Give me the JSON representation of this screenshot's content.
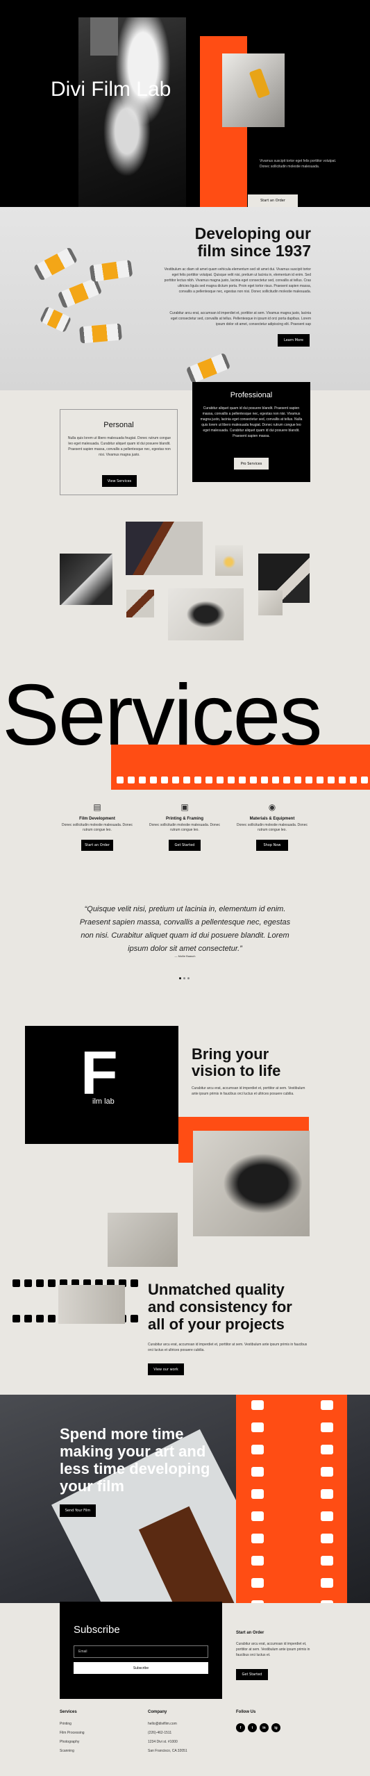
{
  "hero": {
    "title": "Divi Film Lab",
    "text": "Vivamus suscipit tortor eget felis porttitor volutpat. Donec sollicitudin molestie malesuada.",
    "cta_label": "Start an Order"
  },
  "film": {
    "title": "Developing our film since 1937",
    "p1": "Vestibulum ac diam sit amet quam vehicula elementum sed sit amet dui. Vivamus suscipit tortor eget felis porttitor volutpat. Quisque velit nisi, pretium ut lacinia in, elementum id enim. Sed porttitor lectus nibh. Vivamus magna justo, lacinia eget consectetur sed, convallis at tellus. Cras ultricies ligula sed magna dictum porta. Proin eget tortor risus. Praesent sapien massa, convallis a pellentesque nec, egestas non nisi. Donec sollicitudin molestie malesuada.",
    "p2": "Curabitur arcu erat, accumsan id imperdiet et, porttitor at sem. Vivamus magna justo, lacinia eget consectetur sed, convallis at tellus. Pellentesque in ipsum id orci porta dapibus. Lorem ipsum dolor sit amet, consectetur adipiscing elit. Praesent sap",
    "button": "Learn More"
  },
  "cards": {
    "personal": {
      "title": "Personal",
      "text": "Nulla quis lorem ut libero malesuada feugiat. Donec rutrum congue leo eget malesuada. Curabitur aliquet quam id dui posuere blandit. Praesent sapien massa, convallis a pellentesque nec, egestas non nisi. Vivamus magna justo.",
      "button": "View Services"
    },
    "professional": {
      "title": "Professional",
      "text": "Curabitur aliquet quam id dui posuere blandit. Praesent sapien massa, convallis a pellentesque nec, egestas non nisi. Vivamus magna justo, lacinia eget consectetur sed, convallis at tellus. Nulla quis lorem ut libero malesuada feugiat. Donec rutrum congue leo eget malesuada. Curabitur aliquet quam id dui posuere blandit. Praesent sapien massa.",
      "button": "Pro Services"
    }
  },
  "services": {
    "heading": "Services",
    "items": [
      {
        "name": "Film Development",
        "desc": "Donec sollicitudin molestie malesuada. Donec rutrum congue leo.",
        "button": "Start an Order",
        "icon": "film-canister-icon"
      },
      {
        "name": "Printing & Framing",
        "desc": "Donec sollicitudin molestie malesuada. Donec rutrum congue leo.",
        "button": "Get Started",
        "icon": "frame-icon"
      },
      {
        "name": "Materials & Equipment",
        "desc": "Donec sollicitudin molestie malesuada. Donec rutrum congue leo.",
        "button": "Shop Now",
        "icon": "camera-icon"
      }
    ]
  },
  "quote": {
    "text": "“Quisque velit nisi, pretium ut lacinia in, elementum id enim. Praesent sapien massa, convallis a pellentesque nec, egestas non nisi. Curabitur aliquet quam id dui posuere blandit. Lorem ipsum dolor sit amet consectetur.”",
    "author": "— Mollie Baasch"
  },
  "brand": {
    "letter": "F",
    "sub": "ilm lab",
    "title": "Bring your vision to life",
    "text": "Curabitur arcu erat, accumsan id imperdiet et, porttitor at sem. Vestibulum ante ipsum primis in faucibus orci luctus et ultrices posuere cubilia."
  },
  "quality": {
    "title": "Unmatched quality and consistency for all of your projects",
    "text": "Curabitur arcu erat, accumsan id imperdiet et, porttitor at sem. Vestibulum ante ipsum primis in faucibus orci luctus et ultrices posuere cubilia.",
    "button": "View our work"
  },
  "cta": {
    "title": "Spend more time making your art and less time developing your film",
    "button": "Send Your Film"
  },
  "subscribe": {
    "title": "Subscribe",
    "placeholder": "Email",
    "button": "Subscribe"
  },
  "start_order": {
    "title": "Start an Order",
    "text": "Curabitur arcu erat, accumsan id imperdiet et, porttitor at sem. Vestibulum ante ipsum primis in faucibus orci luctus et.",
    "button": "Get Started"
  },
  "footer": {
    "services_title": "Services",
    "services": [
      "Printing",
      "Film Processing",
      "Photography",
      "Scanning"
    ],
    "company_title": "Company",
    "company": [
      "hello@diviflim.com",
      "(226)-462-1511",
      "1234 Divi st. #1000",
      "San Francisco, CA 32051"
    ],
    "follow_title": "Follow Us",
    "social": [
      "f",
      "t",
      "in",
      "ig"
    ]
  },
  "colors": {
    "accent": "#ff4d14",
    "dark": "#000000",
    "background": "#e9e7e2"
  }
}
